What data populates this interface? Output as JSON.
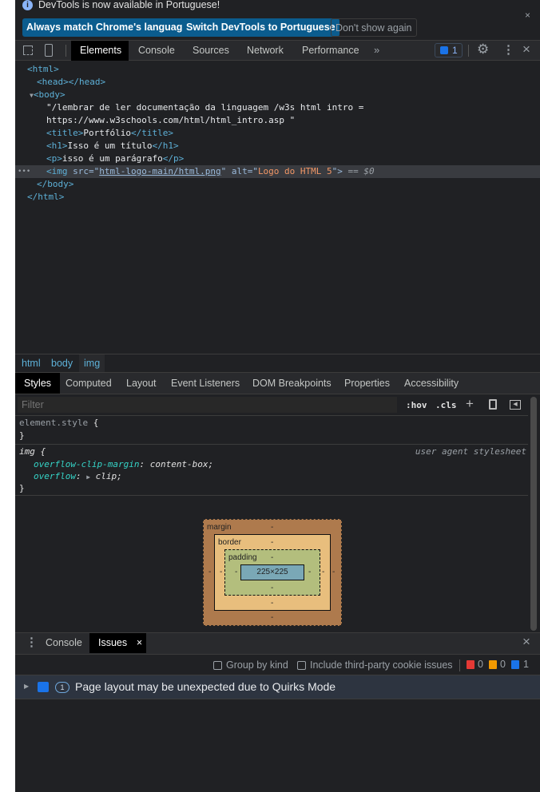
{
  "infobar": {
    "message": "DevTools is now available in Portuguese!",
    "buttons": [
      "Always match Chrome's language",
      "Switch DevTools to Portuguese",
      "Don't show again"
    ]
  },
  "tabs": [
    "Elements",
    "Console",
    "Sources",
    "Network",
    "Performance"
  ],
  "issues_badge": "1",
  "tree": {
    "l1": "<html>",
    "l2": "<head></head>",
    "l3": "<body>",
    "text1": "\"/lembrar de ler documentação da linguagem /w3s html intro =",
    "text2": "https://www.w3schools.com/html/html_intro.asp \"",
    "title_open": "<title>",
    "title_text": "Portfólio",
    "title_close": "</title>",
    "h1_open": "<h1>",
    "h1_text": "Isso é um título",
    "h1_close": "</h1>",
    "p_open": "<p>",
    "p_text": "isso é um parágrafo",
    "p_close": "</p>",
    "img_open": "<img ",
    "img_src_attr": "src=\"",
    "img_src": "html-logo-main/html.png",
    "img_alt_attr": "\" alt=\"",
    "img_alt": "Logo do HTML 5",
    "img_end": "\">",
    "img_ref": " == $0",
    "body_close": "</body>",
    "html_close": "</html>"
  },
  "breadcrumbs": [
    "html",
    "body",
    "img"
  ],
  "subtabs": [
    "Styles",
    "Computed",
    "Layout",
    "Event Listeners",
    "DOM Breakpoints",
    "Properties",
    "Accessibility"
  ],
  "filter": {
    "placeholder": "Filter",
    "hov": ":hov",
    "cls": ".cls"
  },
  "rules": {
    "element_style": "element.style",
    "open": " {",
    "close": "}",
    "img_selector": "img {",
    "origin": "user agent stylesheet",
    "p1_name": "overflow-clip-margin",
    "p1_value": " content-box;",
    "p2_name": "overflow",
    "p2_value": " clip;"
  },
  "boxmodel": {
    "margin": "margin",
    "border": "border",
    "padding": "padding",
    "content": "225×225",
    "dash": "-"
  },
  "drawer": {
    "tabs": [
      "Console",
      "Issues"
    ]
  },
  "issues": {
    "group_by_kind": "Group by kind",
    "third_party": "Include third-party cookie issues",
    "errors": "0",
    "warnings": "0",
    "info": "1",
    "count": "1",
    "message": "Page layout may be unexpected due to Quirks Mode"
  }
}
